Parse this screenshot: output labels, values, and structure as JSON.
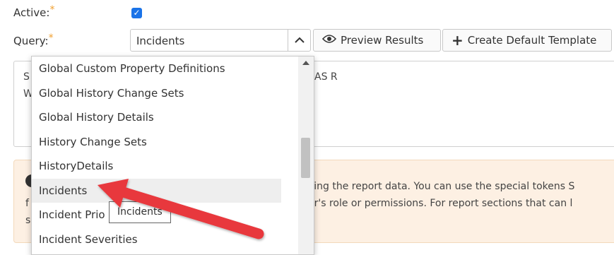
{
  "form": {
    "active_label": "Active:",
    "required_marker": "*",
    "active_checked": true,
    "query_label": "Query:",
    "query_value": "Incidents",
    "preview_button": "Preview Results",
    "template_button": "Create Default Template"
  },
  "editor": {
    "line1_start": "S",
    "line1_end": "AS R",
    "line2_start": "W"
  },
  "info": {
    "line1": "ving the report data. You can use the special tokens S",
    "line2_start": "f",
    "line2_end": "er's role or permissions. For report sections that can l",
    "line3_start": "s"
  },
  "dropdown": {
    "items": [
      "Global Custom Property Definitions",
      "Global History Change Sets",
      "Global History Details",
      "History Change Sets",
      "HistoryDetails",
      "Incidents",
      "Incident Prio",
      "Incident Severities"
    ],
    "highlighted_index": 5
  },
  "tooltip": {
    "text": "Incidents"
  },
  "colors": {
    "arrow": "#e8373d",
    "checkbox": "#1a73e8",
    "required": "#f0a030",
    "info_bg": "#fdf0e3"
  }
}
